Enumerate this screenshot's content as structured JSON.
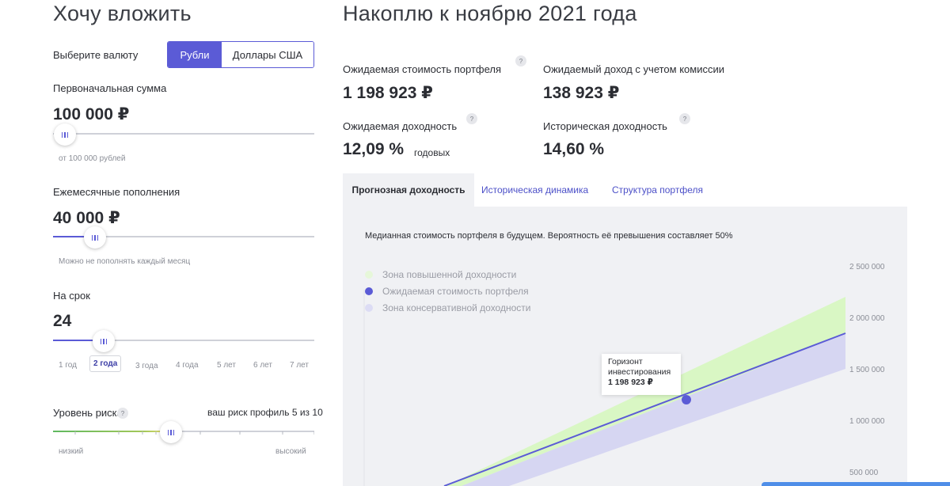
{
  "left": {
    "title": "Хочу вложить",
    "currency": {
      "label": "Выберите валюту",
      "options": [
        "Рубли",
        "Доллары США"
      ]
    },
    "initial": {
      "label": "Первоначальная сумма",
      "value": "100 000 ₽",
      "hint": "от 100 000 рублей",
      "slider_fraction": 0.04
    },
    "monthly": {
      "label": "Ежемесячные пополнения",
      "value": "40 000 ₽",
      "hint": "Можно не пополнять каждый месяц",
      "slider_fraction": 0.16
    },
    "term": {
      "label": "На срок",
      "value": "24",
      "slider_fraction": 0.19,
      "options": [
        "1 год",
        "2 года",
        "3 года",
        "4 года",
        "5 лет",
        "6 лет",
        "7 лет"
      ]
    },
    "risk": {
      "label": "Уровень риска",
      "help": "?",
      "profile": "ваш риск профиль 5 из 10",
      "low": "низкий",
      "high": "высокий",
      "level": 5,
      "max": 10
    }
  },
  "right": {
    "title": "Накоплю к ноябрю 2021 года",
    "stats": {
      "expected_value_label": "Ожидаемая стоимость портфеля",
      "expected_value": "1 198 923 ₽",
      "expected_income_label": "Ожидаемый доход с учетом комиссии",
      "expected_income": "138 923 ₽",
      "expected_yield_label": "Ожидаемая доходность",
      "expected_yield": "12,09 %",
      "expected_yield_suffix": "годовых",
      "historic_yield_label": "Историческая доходность",
      "historic_yield": "14,60 %",
      "help": "?"
    },
    "tabs": [
      "Прогнозная доходность",
      "Историческая динамика",
      "Структура портфеля"
    ],
    "chart": {
      "caption": "Медианная стоимость портфеля в будущем. Вероятность её превышения составляет 50%",
      "legend": [
        {
          "label": "Зона повышенной доходности",
          "color": "#e6f7d9"
        },
        {
          "label": "Ожидаемая стоимость портфеля",
          "color": "#5b5bd6"
        },
        {
          "label": "Зона консервативной доходности",
          "color": "#dcdcf4"
        }
      ],
      "tooltip": {
        "line1": "Горизонт",
        "line2": "инвестирования",
        "value": "1 198 923 ₽"
      },
      "yticks": [
        "2 500 000",
        "2 000 000",
        "1 500 000",
        "1 000 000",
        "500 000"
      ]
    }
  },
  "colors": {
    "accent": "#5b5bd6",
    "upper_zone": "#d9f7c4",
    "lower_zone": "#d6d6f2"
  }
}
